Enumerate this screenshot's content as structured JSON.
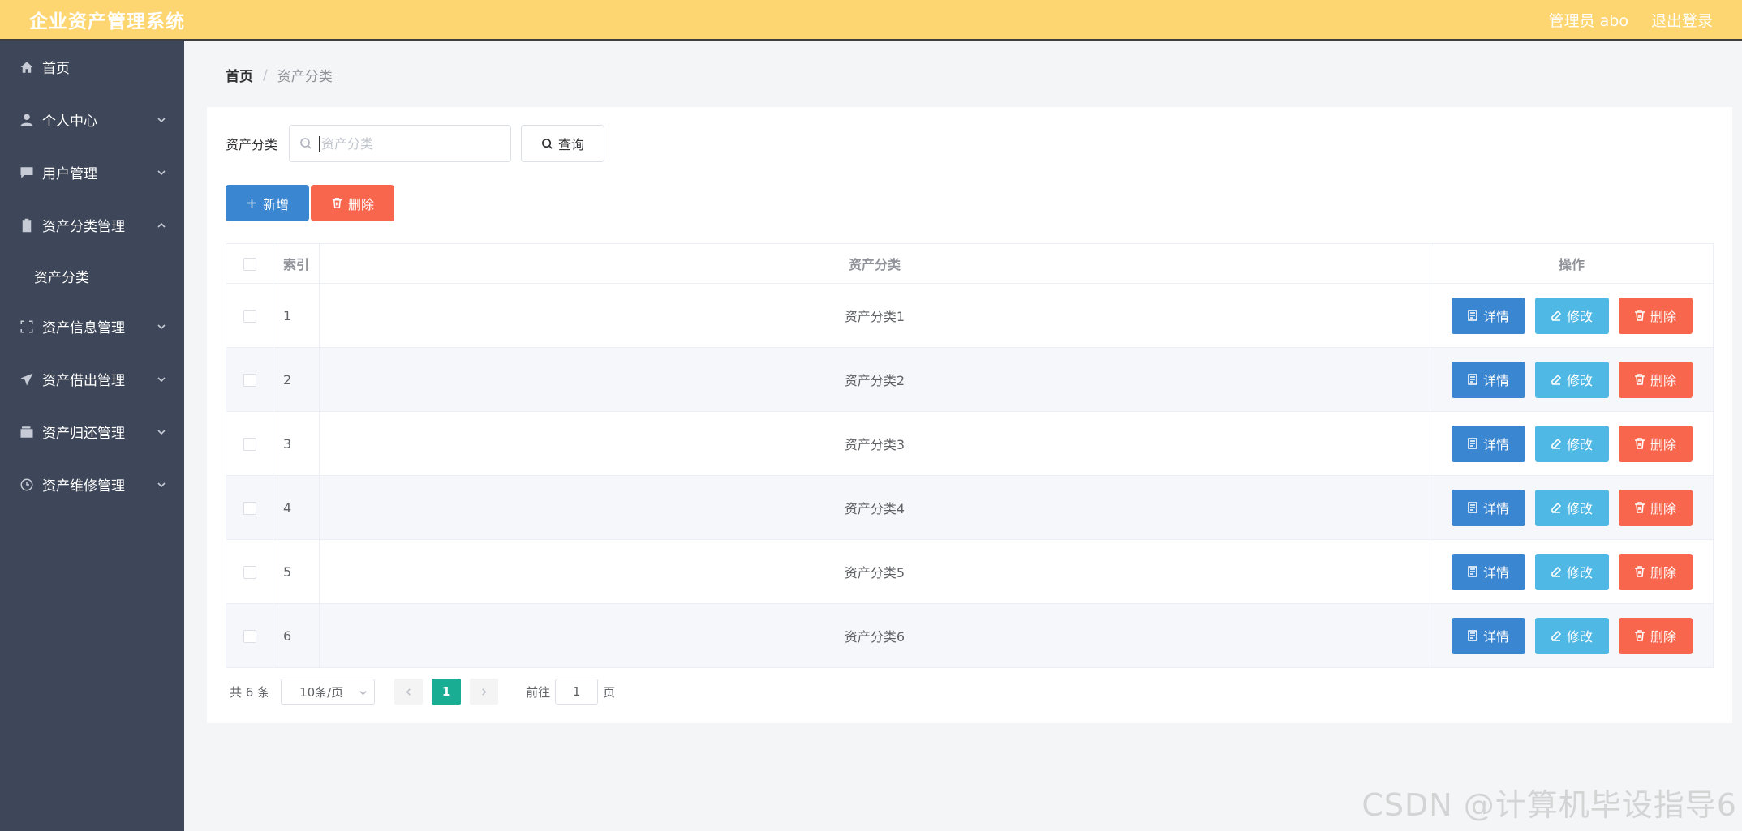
{
  "header": {
    "app_title": "企业资产管理系统",
    "user_label": "管理员 abo",
    "logout_label": "退出登录"
  },
  "sidebar": {
    "items": [
      {
        "label": "首页",
        "icon": "home-icon"
      },
      {
        "label": "个人中心",
        "icon": "user-icon"
      },
      {
        "label": "用户管理",
        "icon": "chat-icon"
      },
      {
        "label": "资产分类管理",
        "icon": "clipboard-icon"
      },
      {
        "label": "资产信息管理",
        "icon": "frame-icon"
      },
      {
        "label": "资产借出管理",
        "icon": "send-icon"
      },
      {
        "label": "资产归还管理",
        "icon": "wallet-icon"
      },
      {
        "label": "资产维修管理",
        "icon": "clock-icon"
      }
    ],
    "submenu_active": "资产分类"
  },
  "breadcrumb": {
    "home": "首页",
    "separator": "/",
    "current": "资产分类"
  },
  "search": {
    "label": "资产分类",
    "placeholder": "资产分类",
    "value": "",
    "query_label": "查询"
  },
  "actions": {
    "add_label": "新增",
    "delete_label": "删除"
  },
  "table": {
    "headers": {
      "index": "索引",
      "category": "资产分类",
      "operations": "操作"
    },
    "rows": [
      {
        "index": "1",
        "category": "资产分类1"
      },
      {
        "index": "2",
        "category": "资产分类2"
      },
      {
        "index": "3",
        "category": "资产分类3"
      },
      {
        "index": "4",
        "category": "资产分类4"
      },
      {
        "index": "5",
        "category": "资产分类5"
      },
      {
        "index": "6",
        "category": "资产分类6"
      }
    ],
    "row_actions": {
      "detail": "详情",
      "edit": "修改",
      "delete": "删除"
    }
  },
  "pagination": {
    "total": "共 6 条",
    "page_size": "10条/页",
    "current_page": "1",
    "goto_prefix": "前往",
    "goto_value": "1",
    "goto_suffix": "页"
  },
  "watermark": "CSDN @计算机毕设指导6",
  "colors": {
    "header_bg": "#fed671",
    "sidebar_bg": "#3e4759",
    "primary_blue": "#3b86d1",
    "edit_blue": "#4fb8e4",
    "danger_red": "#f8674d",
    "page_active": "#19ae94"
  }
}
